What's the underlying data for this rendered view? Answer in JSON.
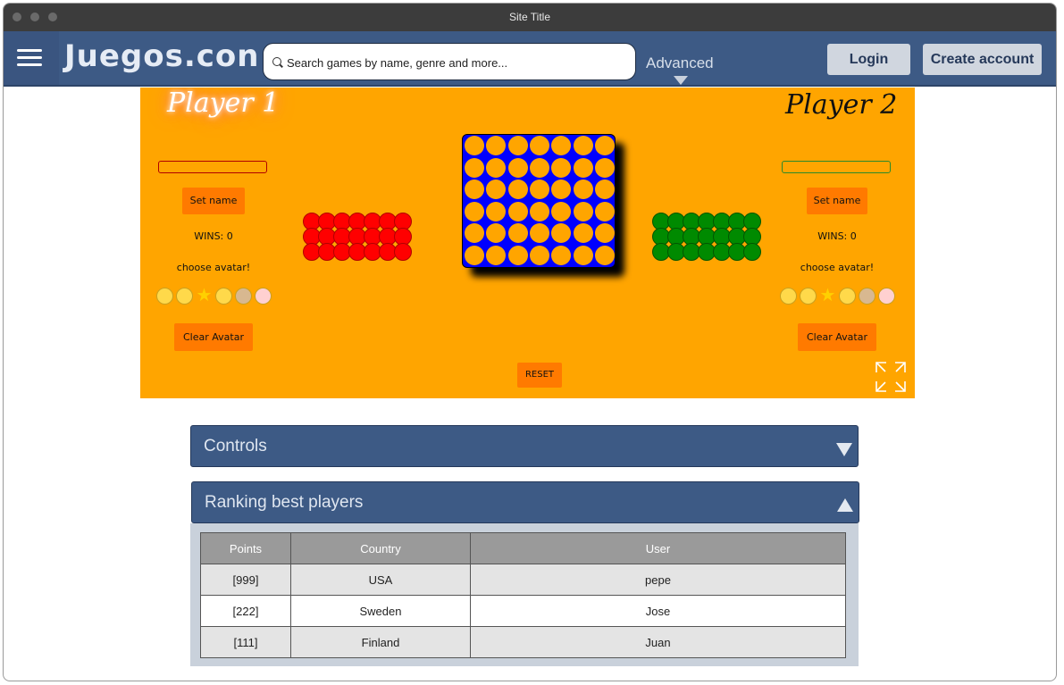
{
  "window": {
    "title": "Site Title"
  },
  "navbar": {
    "logo": "Juegos.con",
    "search_placeholder": "Search games by name, genre and more...",
    "advanced_label": "Advanced",
    "login_label": "Login",
    "create_account_label": "Create account",
    "accent_color": "#3d5a85"
  },
  "game": {
    "player1": {
      "title": "Player 1",
      "set_name_label": "Set name",
      "wins_label": "WINS: 0",
      "choose_avatar_label": "choose avatar!",
      "clear_avatar_label": "Clear Avatar",
      "chip_color": "#ff0000",
      "avatars": [
        "rolling-eyes-face-icon",
        "zany-face-icon",
        "star-icon",
        "thinking-face-icon",
        "old-man-icon",
        "worried-face-icon"
      ]
    },
    "player2": {
      "title": "Player 2",
      "set_name_label": "Set name",
      "wins_label": "WINS: 0",
      "choose_avatar_label": "choose avatar!",
      "clear_avatar_label": "Clear Avatar",
      "chip_color": "#008a00",
      "avatars": [
        "rolling-eyes-face-icon",
        "zany-face-icon",
        "star-icon",
        "thinking-face-icon",
        "old-man-icon",
        "worried-face-icon"
      ]
    },
    "board": {
      "columns": 7,
      "rows": 6,
      "color": "#0000ff"
    },
    "reset_label": "RESET",
    "background_color": "#ffa500"
  },
  "controls": {
    "label": "Controls"
  },
  "ranking": {
    "label": "Ranking best players",
    "columns": [
      "Points",
      "Country",
      "User"
    ],
    "rows": [
      [
        "[999]",
        "USA",
        "pepe"
      ],
      [
        "[222]",
        "Sweden",
        "Jose"
      ],
      [
        "[111]",
        "Finland",
        "Juan"
      ]
    ]
  }
}
